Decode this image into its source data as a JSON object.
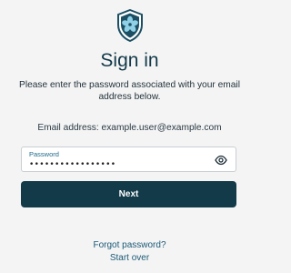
{
  "header": {
    "logo_icon": "shield-flower-icon",
    "title": "Sign in",
    "subtitle": "Please enter the password associated with your email address below."
  },
  "account": {
    "email_line": "Email address: example.user@example.com"
  },
  "password_field": {
    "label": "Password",
    "value": "•••••••••••••••••",
    "toggle_icon": "eye-icon"
  },
  "actions": {
    "next_label": "Next",
    "forgot_label": "Forgot password?",
    "start_over_label": "Start over"
  },
  "colors": {
    "primary": "#133a49",
    "link": "#1b5a78",
    "background": "#f4f4f4"
  }
}
